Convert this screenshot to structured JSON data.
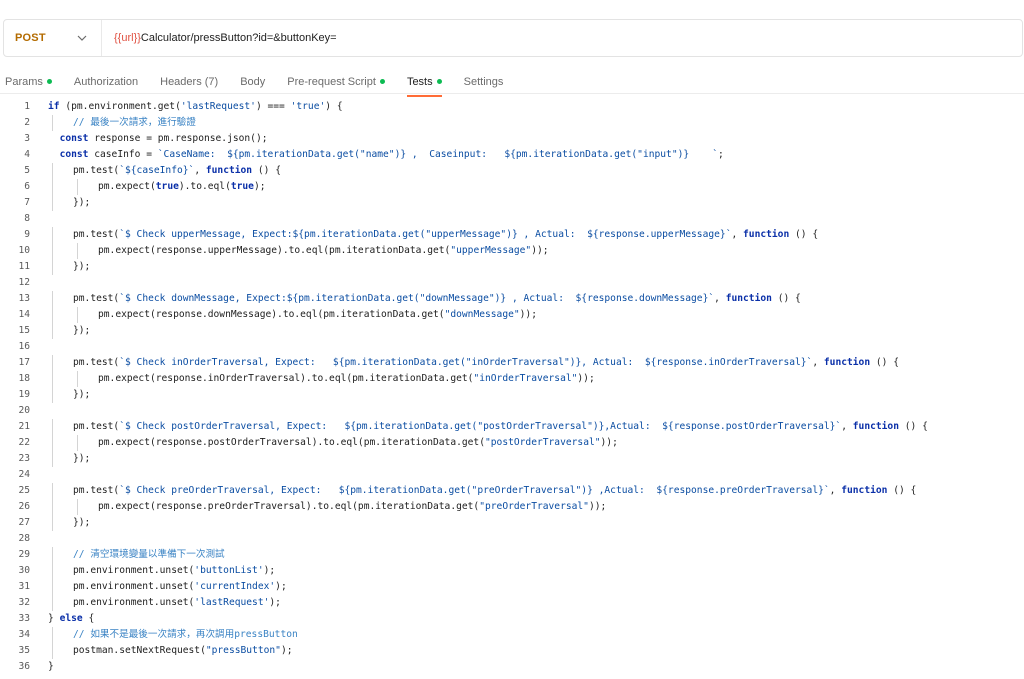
{
  "request": {
    "method": "POST",
    "url_variable": "{{url}}",
    "url_rest": "Calculator/pressButton?id=&buttonKey="
  },
  "tabs": [
    {
      "label": "Params",
      "indicator": "green-dot",
      "active": false
    },
    {
      "label": "Authorization",
      "indicator": "",
      "active": false
    },
    {
      "label": "Headers (7)",
      "indicator": "",
      "active": false
    },
    {
      "label": "Body",
      "indicator": "",
      "active": false
    },
    {
      "label": "Pre-request Script",
      "indicator": "green-dot",
      "active": false
    },
    {
      "label": "Tests",
      "indicator": "green-dot",
      "active": true
    },
    {
      "label": "Settings",
      "indicator": "",
      "active": false
    }
  ],
  "colors": {
    "method": "#b36b00",
    "url_variable": "#e05243",
    "active_tab_underline": "#ff6c37",
    "indicator_dot": "#0cbb52",
    "keyword": "#0a2fa8",
    "string": "#0b4da2",
    "comment": "#3a83c4"
  },
  "code_lines": [
    {
      "n": "1",
      "indent": 0,
      "tokens": [
        [
          "kw",
          "if"
        ],
        [
          "txt",
          " (pm.environment.get("
        ],
        [
          "str",
          "'lastRequest'"
        ],
        [
          "txt",
          ") === "
        ],
        [
          "str",
          "'true'"
        ],
        [
          "txt",
          ") {"
        ]
      ]
    },
    {
      "n": "2",
      "indent": 1,
      "tokens": [
        [
          "cm",
          "// 最後一次請求，進行驗證"
        ]
      ]
    },
    {
      "n": "3",
      "indent": 0,
      "tokens": [
        [
          "txt",
          "  "
        ],
        [
          "kw",
          "const"
        ],
        [
          "txt",
          " response = pm.response.json();"
        ]
      ]
    },
    {
      "n": "4",
      "indent": 0,
      "tokens": [
        [
          "txt",
          "  "
        ],
        [
          "kw",
          "const"
        ],
        [
          "txt",
          " caseInfo = "
        ],
        [
          "str",
          "`CaseName:  ${pm.iterationData.get(\"name\")} ,  Caseinput:   ${pm.iterationData.get(\"input\")}    `"
        ],
        [
          "txt",
          ";"
        ]
      ]
    },
    {
      "n": "5",
      "indent": 1,
      "tokens": [
        [
          "txt",
          "pm.test("
        ],
        [
          "str",
          "`${caseInfo}`"
        ],
        [
          "txt",
          ", "
        ],
        [
          "kw",
          "function"
        ],
        [
          "txt",
          " () {"
        ]
      ]
    },
    {
      "n": "6",
      "indent": 2,
      "tokens": [
        [
          "txt",
          "pm.expect("
        ],
        [
          "kw",
          "true"
        ],
        [
          "txt",
          ").to.eql("
        ],
        [
          "kw",
          "true"
        ],
        [
          "txt",
          ");"
        ]
      ]
    },
    {
      "n": "7",
      "indent": 1,
      "tokens": [
        [
          "txt",
          "});"
        ]
      ]
    },
    {
      "n": "8",
      "indent": 0,
      "tokens": []
    },
    {
      "n": "9",
      "indent": 1,
      "tokens": [
        [
          "txt",
          "pm.test("
        ],
        [
          "str",
          "`$ Check upperMessage, Expect:${pm.iterationData.get(\"upperMessage\")} , Actual:  ${response.upperMessage}`"
        ],
        [
          "txt",
          ", "
        ],
        [
          "kw",
          "function"
        ],
        [
          "txt",
          " () {"
        ]
      ]
    },
    {
      "n": "10",
      "indent": 2,
      "tokens": [
        [
          "txt",
          "pm.expect(response.upperMessage).to.eql(pm.iterationData.get("
        ],
        [
          "str",
          "\"upperMessage\""
        ],
        [
          "txt",
          "));"
        ]
      ]
    },
    {
      "n": "11",
      "indent": 1,
      "tokens": [
        [
          "txt",
          "});"
        ]
      ]
    },
    {
      "n": "12",
      "indent": 0,
      "tokens": []
    },
    {
      "n": "13",
      "indent": 1,
      "tokens": [
        [
          "txt",
          "pm.test("
        ],
        [
          "str",
          "`$ Check downMessage, Expect:${pm.iterationData.get(\"downMessage\")} , Actual:  ${response.downMessage}`"
        ],
        [
          "txt",
          ", "
        ],
        [
          "kw",
          "function"
        ],
        [
          "txt",
          " () {"
        ]
      ]
    },
    {
      "n": "14",
      "indent": 2,
      "tokens": [
        [
          "txt",
          "pm.expect(response.downMessage).to.eql(pm.iterationData.get("
        ],
        [
          "str",
          "\"downMessage\""
        ],
        [
          "txt",
          "));"
        ]
      ]
    },
    {
      "n": "15",
      "indent": 1,
      "tokens": [
        [
          "txt",
          "});"
        ]
      ]
    },
    {
      "n": "16",
      "indent": 0,
      "tokens": []
    },
    {
      "n": "17",
      "indent": 1,
      "tokens": [
        [
          "txt",
          "pm.test("
        ],
        [
          "str",
          "`$ Check inOrderTraversal, Expect:   ${pm.iterationData.get(\"inOrderTraversal\")}, Actual:  ${response.inOrderTraversal}`"
        ],
        [
          "txt",
          ", "
        ],
        [
          "kw",
          "function"
        ],
        [
          "txt",
          " () {"
        ]
      ]
    },
    {
      "n": "18",
      "indent": 2,
      "tokens": [
        [
          "txt",
          "pm.expect(response.inOrderTraversal).to.eql(pm.iterationData.get("
        ],
        [
          "str",
          "\"inOrderTraversal\""
        ],
        [
          "txt",
          "));"
        ]
      ]
    },
    {
      "n": "19",
      "indent": 1,
      "tokens": [
        [
          "txt",
          "});"
        ]
      ]
    },
    {
      "n": "20",
      "indent": 0,
      "tokens": []
    },
    {
      "n": "21",
      "indent": 1,
      "tokens": [
        [
          "txt",
          "pm.test("
        ],
        [
          "str",
          "`$ Check postOrderTraversal, Expect:   ${pm.iterationData.get(\"postOrderTraversal\")},Actual:  ${response.postOrderTraversal}`"
        ],
        [
          "txt",
          ", "
        ],
        [
          "kw",
          "function"
        ],
        [
          "txt",
          " () {"
        ]
      ]
    },
    {
      "n": "22",
      "indent": 2,
      "tokens": [
        [
          "txt",
          "pm.expect(response.postOrderTraversal).to.eql(pm.iterationData.get("
        ],
        [
          "str",
          "\"postOrderTraversal\""
        ],
        [
          "txt",
          "));"
        ]
      ]
    },
    {
      "n": "23",
      "indent": 1,
      "tokens": [
        [
          "txt",
          "});"
        ]
      ]
    },
    {
      "n": "24",
      "indent": 0,
      "tokens": []
    },
    {
      "n": "25",
      "indent": 1,
      "tokens": [
        [
          "txt",
          "pm.test("
        ],
        [
          "str",
          "`$ Check preOrderTraversal, Expect:   ${pm.iterationData.get(\"preOrderTraversal\")} ,Actual:  ${response.preOrderTraversal}`"
        ],
        [
          "txt",
          ", "
        ],
        [
          "kw",
          "function"
        ],
        [
          "txt",
          " () {"
        ]
      ]
    },
    {
      "n": "26",
      "indent": 2,
      "tokens": [
        [
          "txt",
          "pm.expect(response.preOrderTraversal).to.eql(pm.iterationData.get("
        ],
        [
          "str",
          "\"preOrderTraversal\""
        ],
        [
          "txt",
          "));"
        ]
      ]
    },
    {
      "n": "27",
      "indent": 1,
      "tokens": [
        [
          "txt",
          "});"
        ]
      ]
    },
    {
      "n": "28",
      "indent": 0,
      "tokens": []
    },
    {
      "n": "29",
      "indent": 1,
      "tokens": [
        [
          "cm",
          "// 清空環境變量以準備下一次測試"
        ]
      ]
    },
    {
      "n": "30",
      "indent": 1,
      "tokens": [
        [
          "txt",
          "pm.environment.unset("
        ],
        [
          "str",
          "'buttonList'"
        ],
        [
          "txt",
          ");"
        ]
      ]
    },
    {
      "n": "31",
      "indent": 1,
      "tokens": [
        [
          "txt",
          "pm.environment.unset("
        ],
        [
          "str",
          "'currentIndex'"
        ],
        [
          "txt",
          ");"
        ]
      ]
    },
    {
      "n": "32",
      "indent": 1,
      "tokens": [
        [
          "txt",
          "pm.environment.unset("
        ],
        [
          "str",
          "'lastRequest'"
        ],
        [
          "txt",
          ");"
        ]
      ]
    },
    {
      "n": "33",
      "indent": 0,
      "tokens": [
        [
          "txt",
          "} "
        ],
        [
          "kw",
          "else"
        ],
        [
          "txt",
          " {"
        ]
      ]
    },
    {
      "n": "34",
      "indent": 1,
      "tokens": [
        [
          "cm",
          "// 如果不是最後一次請求，再次調用pressButton"
        ]
      ]
    },
    {
      "n": "35",
      "indent": 1,
      "tokens": [
        [
          "txt",
          "postman.setNextRequest("
        ],
        [
          "str",
          "\"pressButton\""
        ],
        [
          "txt",
          ");"
        ]
      ]
    },
    {
      "n": "36",
      "indent": 0,
      "tokens": [
        [
          "txt",
          "}"
        ]
      ]
    }
  ]
}
